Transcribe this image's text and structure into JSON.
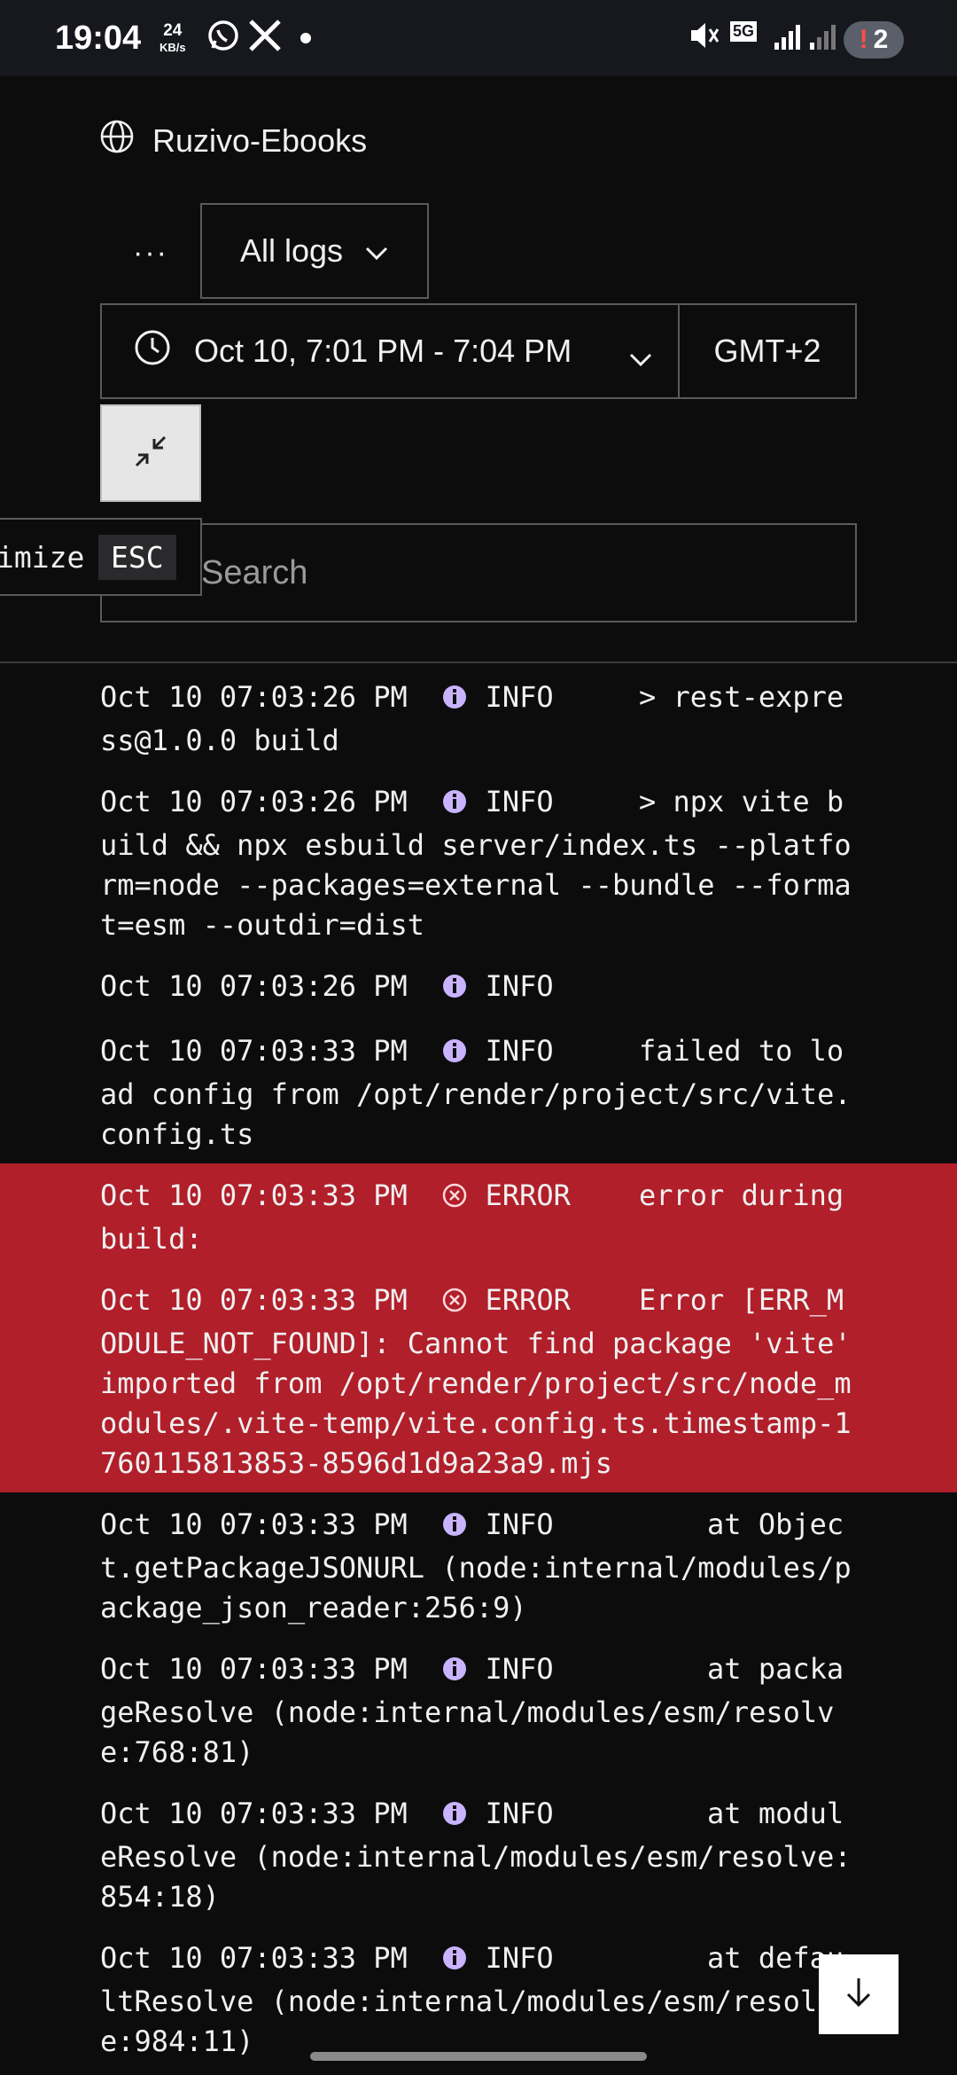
{
  "status_bar": {
    "time": "19:04",
    "speed_value": "24",
    "speed_unit": "KB/s",
    "network": "5G",
    "notification_count": "2"
  },
  "header": {
    "project_name": "Ruzivo-Ebooks",
    "more_label": "···",
    "log_filter": "All logs",
    "time_range": "Oct 10, 7:01 PM - 7:04 PM",
    "timezone": "GMT+2",
    "search_placeholder": "Search",
    "tooltip_text": "imize",
    "tooltip_key": "ESC"
  },
  "logs": [
    {
      "ts": "Oct 10 07:03:26 PM",
      "level": "INFO",
      "msg": "     > rest-express@1.0.0 build"
    },
    {
      "ts": "Oct 10 07:03:26 PM",
      "level": "INFO",
      "msg": "     > npx vite build && npx esbuild server/index.ts --platform=node --packages=external --bundle --format=esm --outdir=dist"
    },
    {
      "ts": "Oct 10 07:03:26 PM",
      "level": "INFO",
      "msg": ""
    },
    {
      "ts": "Oct 10 07:03:33 PM",
      "level": "INFO",
      "msg": "     failed to load config from /opt/render/project/src/vite.config.ts"
    },
    {
      "ts": "Oct 10 07:03:33 PM",
      "level": "ERROR",
      "msg": "    error during build:"
    },
    {
      "ts": "Oct 10 07:03:33 PM",
      "level": "ERROR",
      "msg": "    Error [ERR_MODULE_NOT_FOUND]: Cannot find package 'vite' imported from /opt/render/project/src/node_modules/.vite-temp/vite.config.ts.timestamp-1760115813853-8596d1d9a23a9.mjs"
    },
    {
      "ts": "Oct 10 07:03:33 PM",
      "level": "INFO",
      "msg": "         at Object.getPackageJSONURL (node:internal/modules/package_json_reader:256:9)"
    },
    {
      "ts": "Oct 10 07:03:33 PM",
      "level": "INFO",
      "msg": "         at packageResolve (node:internal/modules/esm/resolve:768:81)"
    },
    {
      "ts": "Oct 10 07:03:33 PM",
      "level": "INFO",
      "msg": "         at moduleResolve (node:internal/modules/esm/resolve:854:18)"
    },
    {
      "ts": "Oct 10 07:03:33 PM",
      "level": "INFO",
      "msg": "         at defaultResolve (node:internal/modules/esm/resolve:984:11)"
    }
  ],
  "colors": {
    "error_row": "#b01f2a",
    "info_icon": "#c9b3ff"
  }
}
